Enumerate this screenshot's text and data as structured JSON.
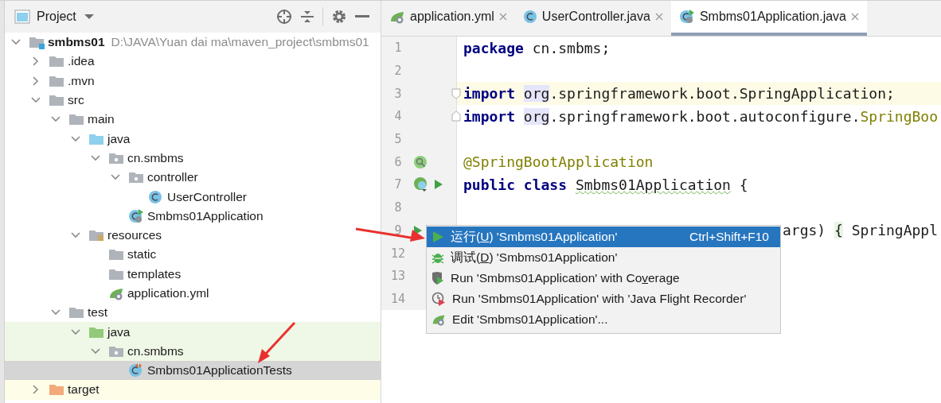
{
  "project_panel": {
    "title": "Project",
    "tree": [
      {
        "label": "smbms01",
        "path": "D:\\JAVA\\Yuan dai ma\\maven_project\\smbms01",
        "kind": "module",
        "expanded": true,
        "selected": false,
        "children": [
          {
            "label": ".idea",
            "kind": "folder",
            "expanded": false,
            "selected": false
          },
          {
            "label": ".mvn",
            "kind": "folder",
            "expanded": false,
            "selected": false
          },
          {
            "label": "src",
            "kind": "folder",
            "expanded": true,
            "selected": false,
            "children": [
              {
                "label": "main",
                "kind": "folder",
                "expanded": true,
                "selected": false,
                "children": [
                  {
                    "label": "java",
                    "kind": "source",
                    "expanded": true,
                    "selected": false,
                    "children": [
                      {
                        "label": "cn.smbms",
                        "kind": "package",
                        "expanded": true,
                        "selected": false,
                        "children": [
                          {
                            "label": "controller",
                            "kind": "package",
                            "expanded": true,
                            "selected": false,
                            "children": [
                              {
                                "label": "UserController",
                                "kind": "class",
                                "selected": false
                              }
                            ]
                          },
                          {
                            "label": "Smbms01Application",
                            "kind": "boot-class",
                            "selected": false
                          }
                        ]
                      }
                    ]
                  },
                  {
                    "label": "resources",
                    "kind": "resources",
                    "expanded": true,
                    "selected": false,
                    "children": [
                      {
                        "label": "static",
                        "kind": "folder",
                        "selected": false
                      },
                      {
                        "label": "templates",
                        "kind": "folder",
                        "selected": false
                      },
                      {
                        "label": "application.yml",
                        "kind": "yml",
                        "selected": false
                      }
                    ]
                  }
                ]
              },
              {
                "label": "test",
                "kind": "folder",
                "expanded": true,
                "selected": false,
                "children": [
                  {
                    "label": "java",
                    "kind": "test-source",
                    "expanded": true,
                    "selected": false,
                    "color": "#eff8e6",
                    "children": [
                      {
                        "label": "cn.smbms",
                        "kind": "package",
                        "expanded": true,
                        "selected": false,
                        "color": "#eff8e6",
                        "children": [
                          {
                            "label": "Smbms01ApplicationTests",
                            "kind": "test-class",
                            "selected": true
                          }
                        ]
                      }
                    ]
                  }
                ]
              }
            ]
          },
          {
            "label": "target",
            "kind": "excluded",
            "expanded": false,
            "selected": false,
            "color": "#fdfde8"
          }
        ]
      }
    ]
  },
  "editor": {
    "tabs": [
      {
        "label": "application.yml",
        "kind": "yml",
        "selected": false
      },
      {
        "label": "UserController.java",
        "kind": "class",
        "selected": false
      },
      {
        "label": "Smbms01Application.java",
        "kind": "boot-class",
        "selected": true
      }
    ],
    "lines": [
      {
        "number": "1",
        "tokens": [
          {
            "text": "package ",
            "kind": "keyword"
          },
          {
            "text": "cn.smbms;",
            "kind": "plain"
          }
        ]
      },
      {
        "number": "2"
      },
      {
        "number": "3",
        "current": true,
        "gutter": [
          {
            "kind": "fold-start"
          }
        ],
        "tokens": [
          {
            "text": "import ",
            "kind": "keyword"
          },
          {
            "text": "org",
            "kind": "hl"
          },
          {
            "text": ".springframework.boot.SpringApplication;",
            "kind": "plain"
          }
        ]
      },
      {
        "number": "4",
        "gutter": [
          {
            "kind": "fold-end"
          }
        ],
        "tokens": [
          {
            "text": "import ",
            "kind": "keyword"
          },
          {
            "text": "org",
            "kind": "hl"
          },
          {
            "text": ".springframework.boot.autoconfigure.",
            "kind": "plain"
          },
          {
            "text": "SpringBoo",
            "kind": "unused"
          }
        ]
      },
      {
        "number": "5"
      },
      {
        "number": "6",
        "gutter": [
          {
            "kind": "bean"
          }
        ],
        "tokens": [
          {
            "text": "@SpringBootApplication",
            "kind": "annotation"
          }
        ]
      },
      {
        "number": "7",
        "gutter": [
          {
            "kind": "boot"
          },
          {
            "kind": "run"
          }
        ],
        "tokens": [
          {
            "text": "public ",
            "kind": "keyword"
          },
          {
            "text": "class ",
            "kind": "keyword"
          },
          {
            "text": "Smbms01Application",
            "kind": "typo"
          },
          {
            "text": " {",
            "kind": "plain"
          }
        ]
      },
      {
        "number": "8"
      },
      {
        "number": "9",
        "kind": "partly-covered",
        "gutter": [
          {
            "kind": "run"
          }
        ],
        "tokens": [
          {
            "text": "args) ",
            "kind": "plain"
          },
          {
            "text": "{",
            "kind": "brace"
          },
          {
            "text": " SpringAppl",
            "kind": "plain"
          }
        ]
      },
      {
        "number": "12"
      },
      {
        "number": "13"
      },
      {
        "number": "14"
      }
    ]
  },
  "context_menu": {
    "items": [
      {
        "kind": "run",
        "before": "运行(",
        "mnemonic": "U",
        "after": ") 'Smbms01Application'",
        "shortcut": "Ctrl+Shift+F10",
        "selected": true
      },
      {
        "kind": "debug",
        "before": "调试(",
        "mnemonic": "D",
        "after": ") 'Smbms01Application'",
        "selected": false
      },
      {
        "kind": "coverage",
        "before": "Run 'Smbms01Application' with Co",
        "mnemonic": "v",
        "after": "erage",
        "selected": false
      },
      {
        "kind": "profiler",
        "before": "Run 'Smbms01Application' with 'Java Flight Recorder'",
        "selected": false
      },
      {
        "kind": "edit",
        "before": "Edit 'Smbms01Application'...",
        "selected": false
      }
    ]
  }
}
